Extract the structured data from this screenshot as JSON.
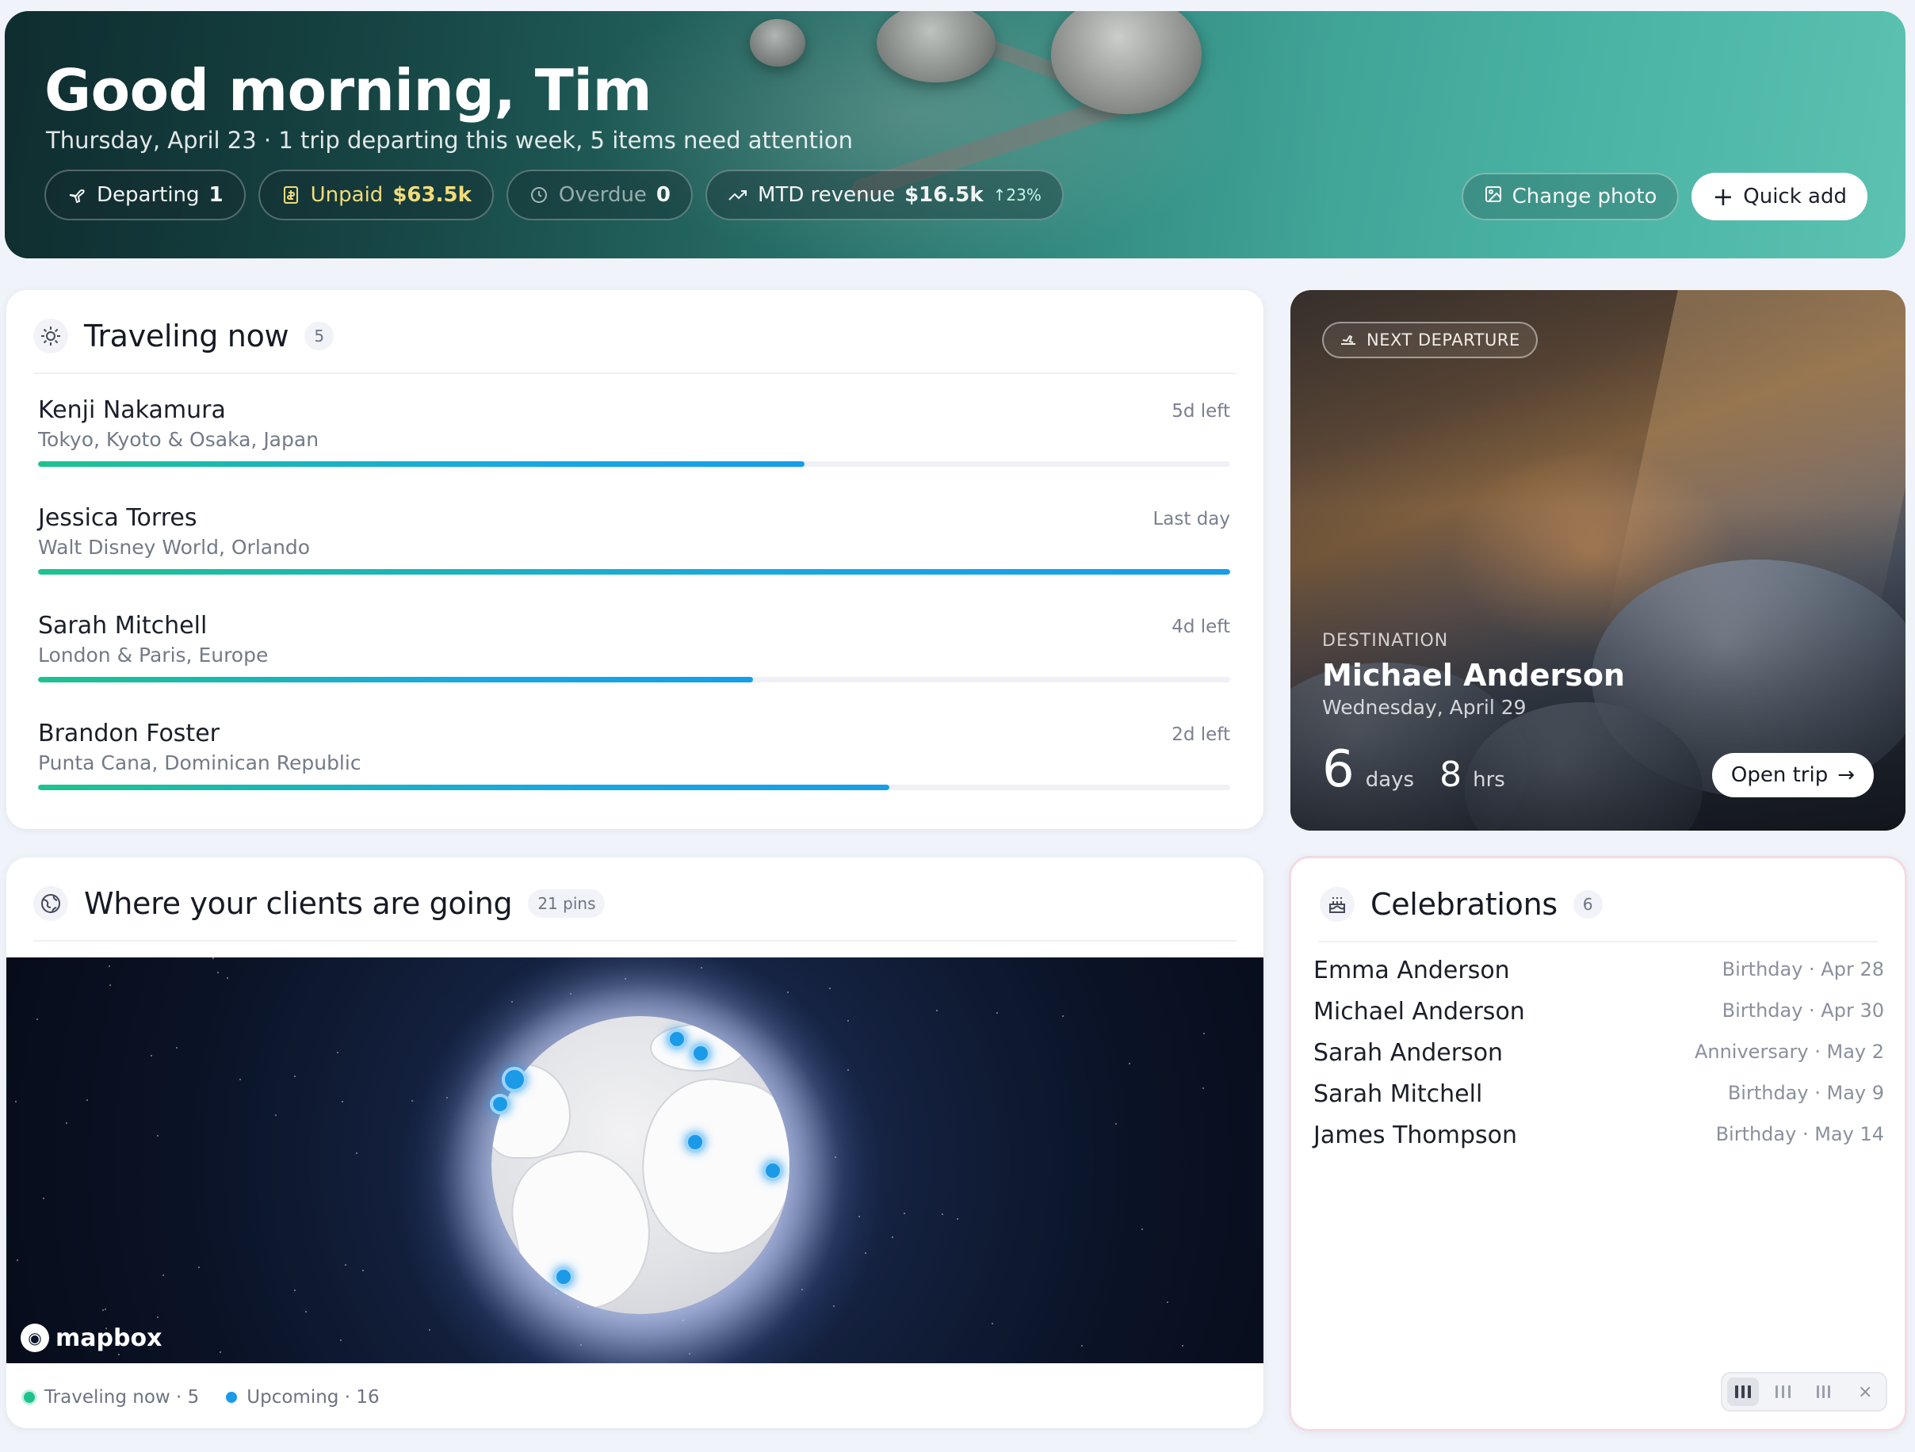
{
  "hero": {
    "greeting": "Good morning, Tim",
    "subtitle": "Thursday, April 23 · 1 trip departing this week, 5 items need attention",
    "chips": [
      {
        "label": "Departing",
        "value": "1",
        "icon": "plane-icon"
      },
      {
        "label": "Unpaid",
        "value": "$63.5k",
        "icon": "invoice-icon"
      },
      {
        "label": "Overdue",
        "value": "0",
        "icon": "clock-icon"
      },
      {
        "label": "MTD revenue",
        "value": "$16.5k",
        "delta": "↑23%",
        "icon": "trend-up-icon"
      }
    ],
    "change_photo_label": "Change photo",
    "quick_add_label": "Quick add"
  },
  "traveling_now": {
    "title": "Traveling now",
    "count": "5",
    "trips": [
      {
        "name": "Kenji Nakamura",
        "destination": "Tokyo, Kyoto & Osaka, Japan",
        "remaining": "5d left",
        "progress": 0.643
      },
      {
        "name": "Jessica Torres",
        "destination": "Walt Disney World, Orlando",
        "remaining": "Last day",
        "progress": 1.0
      },
      {
        "name": "Sarah Mitchell",
        "destination": "London & Paris, Europe",
        "remaining": "4d left",
        "progress": 0.6
      },
      {
        "name": "Brandon Foster",
        "destination": "Punta Cana, Dominican Republic",
        "remaining": "2d left",
        "progress": 0.714
      }
    ]
  },
  "next_departure": {
    "tag": "NEXT DEPARTURE",
    "destination_label": "DESTINATION",
    "client": "Michael Anderson",
    "date": "Wednesday, April 29",
    "days": "6",
    "days_unit": "days",
    "hours": "8",
    "hours_unit": "hrs",
    "open_label": "Open trip"
  },
  "clients_map": {
    "title": "Where your clients are going",
    "pins_label": "21 pins",
    "attribution": "mapbox",
    "legend": [
      {
        "label": "Traveling now · 5",
        "color": "#1fc28e"
      },
      {
        "label": "Upcoming · 16",
        "color": "#1b9ae8"
      }
    ]
  },
  "celebrations": {
    "title": "Celebrations",
    "count": "6",
    "items": [
      {
        "name": "Emma Anderson",
        "event": "Birthday · Apr 28"
      },
      {
        "name": "Michael Anderson",
        "event": "Birthday · Apr 30"
      },
      {
        "name": "Sarah Anderson",
        "event": "Anniversary · May 2"
      },
      {
        "name": "Sarah Mitchell",
        "event": "Birthday · May 9"
      },
      {
        "name": "James Thompson",
        "event": "Birthday · May 14"
      }
    ]
  }
}
